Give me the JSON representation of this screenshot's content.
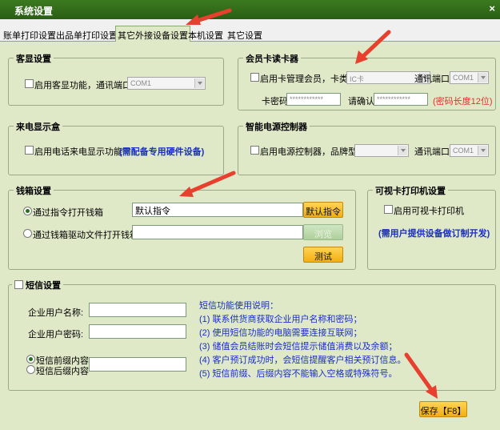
{
  "window": {
    "title": "系统设置",
    "close": "×"
  },
  "tabs": [
    {
      "label": "账单打印设置"
    },
    {
      "label": "出品单打印设置"
    },
    {
      "label": "其它外接设备设置",
      "active": true
    },
    {
      "label": "本机设置"
    },
    {
      "label": "其它设置"
    }
  ],
  "customer_display": {
    "title": "客显设置",
    "enable_label": "启用客显功能，通讯端口",
    "port_value": "COM1"
  },
  "card_reader": {
    "title": "会员卡读卡器",
    "enable_label": "启用卡管理会员，卡类型",
    "card_type_value": "IC卡",
    "port_label": "通讯端口",
    "port_value": "COM1",
    "password_label": "卡密码",
    "password_value": "************",
    "confirm_label": "请确认",
    "confirm_value": "************",
    "hint": "(密码长度12位)"
  },
  "caller_id": {
    "title": "来电显示盒",
    "enable_label": "启用电话来电显示功能",
    "note": "(需配备专用硬件设备)"
  },
  "power_controller": {
    "title": "智能电源控制器",
    "enable_label": "启用电源控制器，品牌型号",
    "brand_value": "",
    "port_label": "通讯端口",
    "port_value": "COM1"
  },
  "cash_drawer": {
    "title": "钱箱设置",
    "option_command": "通过指令打开钱箱",
    "command_value": "默认指令",
    "default_button": "默认指令",
    "option_driver": "通过钱箱驱动文件打开钱箱",
    "driver_value": "",
    "browse_button": "浏览",
    "test_button": "测试"
  },
  "visual_card_printer": {
    "title": "可视卡打印机设置",
    "enable_label": "启用可视卡打印机",
    "note": "(需用户提供设备做订制开发)"
  },
  "sms": {
    "title": "短信设置",
    "user_name_label": "企业用户名称:",
    "user_name_value": "",
    "user_pw_label": "企业用户密码:",
    "user_pw_value": "",
    "prefix_label": "短信前缀内容",
    "suffix_label": "短信后缀内容",
    "affix_value": "",
    "info_title": "短信功能使用说明：",
    "info_lines": [
      "(1) 联系供货商获取企业用户名称和密码；",
      "(2) 使用短信功能的电脑需要连接互联网；",
      "(3) 储值会员结账时会短信提示储值消费以及余额；",
      "(4) 客户预订成功时，会短信提醒客户相关预订信息。",
      "(5) 短信前缀、后缀内容不能输入空格或特殊符号。"
    ]
  },
  "save_button": "保存【F8】",
  "colors": {
    "accent_arrow": "#e8402e",
    "title_bg": "#2f6a18",
    "panel_bg": "#dfe9c8",
    "button": "#f5b51c",
    "info_text": "#1a2ec6"
  }
}
